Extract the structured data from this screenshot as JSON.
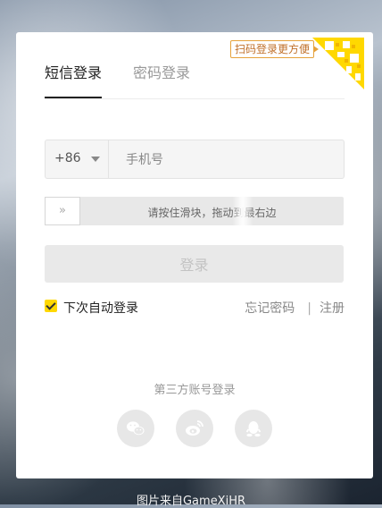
{
  "tabs": [
    "短信登录",
    "密码登录"
  ],
  "qr_tip": "扫码登录更方便",
  "phone": {
    "country_code": "+86",
    "placeholder": "手机号",
    "value": ""
  },
  "slider": {
    "handle": "»",
    "text": "请按住滑块，拖动到最右边"
  },
  "login_button": "登录",
  "auto_login": {
    "label": "下次自动登录",
    "checked": true
  },
  "links": {
    "forgot": "忘记密码",
    "separator": "|",
    "register": "注册"
  },
  "third_party": {
    "title": "第三方账号登录",
    "providers": [
      "wechat-icon",
      "weibo-icon",
      "qq-icon"
    ]
  },
  "footer": "图片来自GameXiHR",
  "colors": {
    "accent": "#ffd800",
    "qr_tip": "#e6a23c"
  }
}
